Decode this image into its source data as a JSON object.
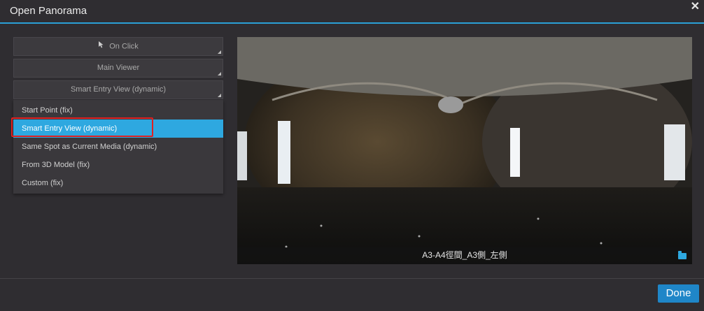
{
  "dialog": {
    "title": "Open Panorama",
    "close_label": "✕"
  },
  "options": {
    "trigger_label": "On Click",
    "viewer_label": "Main Viewer",
    "entry_view_label": "Smart Entry View (dynamic)"
  },
  "entry_view_menu": {
    "items": [
      {
        "label": "Start Point (fix)",
        "selected": false
      },
      {
        "label": "Smart Entry View (dynamic)",
        "selected": true
      },
      {
        "label": "Same Spot as Current Media (dynamic)",
        "selected": false
      },
      {
        "label": "From 3D Model (fix)",
        "selected": false
      },
      {
        "label": "Custom (fix)",
        "selected": false
      }
    ]
  },
  "preview": {
    "caption": "A3-A4徑間_A3側_左側",
    "folder_icon": "folder-icon"
  },
  "footer": {
    "done_label": "Done"
  },
  "colors": {
    "accent": "#2aa0d6",
    "selected": "#2ea8e0",
    "highlight": "#e02020",
    "done_button": "#1f86c8"
  }
}
